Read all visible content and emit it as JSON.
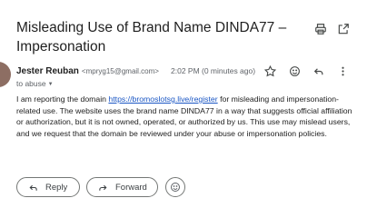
{
  "email": {
    "subject": "Misleading Use of Brand Name DINDA77 – Impersonation",
    "sender": {
      "name": "Jester Reuban",
      "email": "<mpryg15@gmail.com>"
    },
    "time": "2:02 PM (0 minutes ago)",
    "to": "to abuse",
    "body": {
      "before_link": "I am reporting the domain ",
      "link": "https://bromoslotsg.live/register",
      "after_link": " for misleading and impersonation-related use. The website uses the brand name DINDA77 in a way that suggests official affiliation or authorization, but it is not owned, operated, or authorized by us. This use may mislead users, and we request that the domain be reviewed under your abuse or impersonation policies."
    }
  },
  "actions": {
    "reply_label": "Reply",
    "forward_label": "Forward"
  },
  "icons": {
    "top": [
      "print-icon",
      "open-in-new-window-icon"
    ],
    "message": [
      "star-icon",
      "emoji-icon",
      "reply-icon",
      "more-vert-icon"
    ],
    "buttons": [
      "reply-icon",
      "forward-icon",
      "emoji-icon"
    ]
  },
  "colors": {
    "link": "#1a56c4",
    "avatar": "#8d6e63",
    "secondary_text": "#5f6368"
  }
}
